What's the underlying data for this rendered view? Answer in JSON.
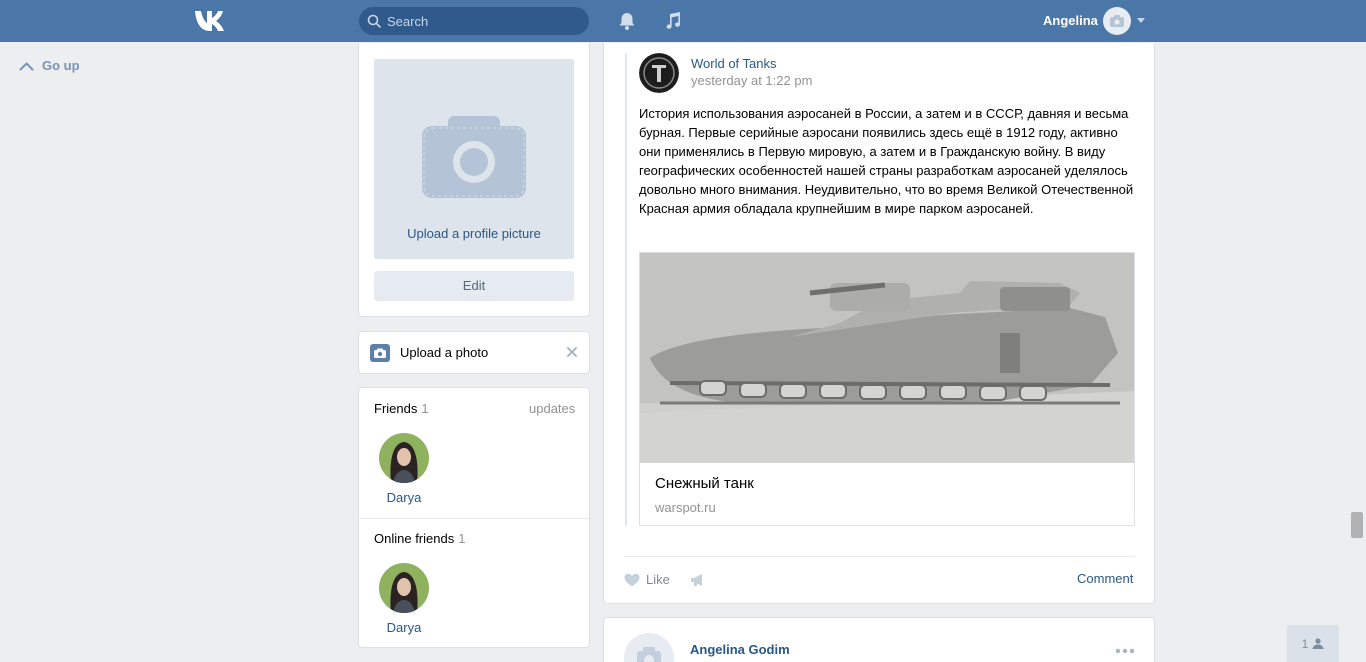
{
  "header": {
    "search_placeholder": "Search",
    "user_name": "Angelina",
    "accent": "#4a76a8"
  },
  "goup": {
    "label": "Go up"
  },
  "profile": {
    "upload_link": "Upload a profile picture",
    "edit_label": "Edit"
  },
  "upload_photo": {
    "label": "Upload a photo"
  },
  "friends": {
    "title": "Friends",
    "count": "1",
    "updates_label": "updates",
    "items": [
      {
        "name": "Darya"
      }
    ]
  },
  "online_friends": {
    "title": "Online friends",
    "count": "1",
    "items": [
      {
        "name": "Darya"
      }
    ]
  },
  "post": {
    "author": "World of Tanks",
    "date": "yesterday at 1:22 pm",
    "text": "История использования аэросаней в России, а затем и в СССР, давняя и весьма бурная. Первые серийные аэросани появились здесь ещё в 1912 году, активно они применялись в Первую мировую, а затем и в Гражданскую войну. В виду географических особенностей нашей страны разработкам аэросаней уделялось довольно много внимания. Неудивительно, что во время Великой Отечественной Красная армия обладала крупнейшим в мире парком аэросаней.",
    "attachment": {
      "title": "Снежный танк",
      "domain": "warspot.ru"
    },
    "like_label": "Like",
    "comment_label": "Comment"
  },
  "post2": {
    "author": "Angelina Godim"
  },
  "online_counter": {
    "count": "1"
  }
}
